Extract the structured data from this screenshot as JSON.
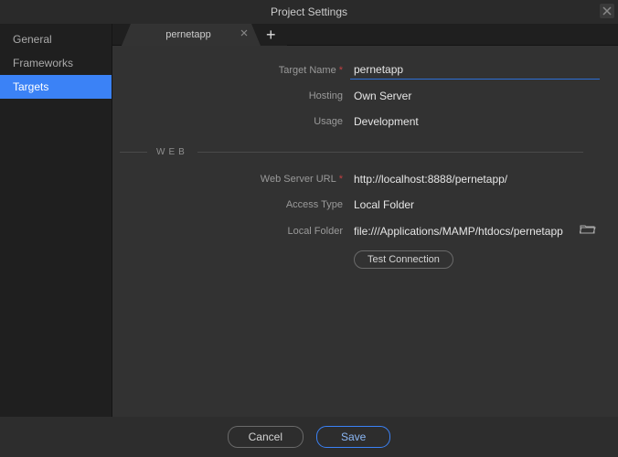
{
  "window": {
    "title": "Project Settings"
  },
  "sidebar": {
    "items": [
      {
        "label": "General"
      },
      {
        "label": "Frameworks"
      },
      {
        "label": "Targets"
      }
    ]
  },
  "tabs": {
    "items": [
      {
        "label": "pernetapp"
      }
    ]
  },
  "form": {
    "target_name": {
      "label": "Target Name",
      "value": "pernetapp"
    },
    "hosting": {
      "label": "Hosting",
      "value": "Own Server"
    },
    "usage": {
      "label": "Usage",
      "value": "Development"
    }
  },
  "section_web": {
    "title": "WEB"
  },
  "web": {
    "server_url": {
      "label": "Web Server URL",
      "value": "http://localhost:8888/pernetapp/"
    },
    "access_type": {
      "label": "Access Type",
      "value": "Local Folder"
    },
    "local_folder": {
      "label": "Local Folder",
      "value": "file:///Applications/MAMP/htdocs/pernetapp"
    },
    "test_connection": "Test Connection"
  },
  "footer": {
    "cancel": "Cancel",
    "save": "Save"
  }
}
